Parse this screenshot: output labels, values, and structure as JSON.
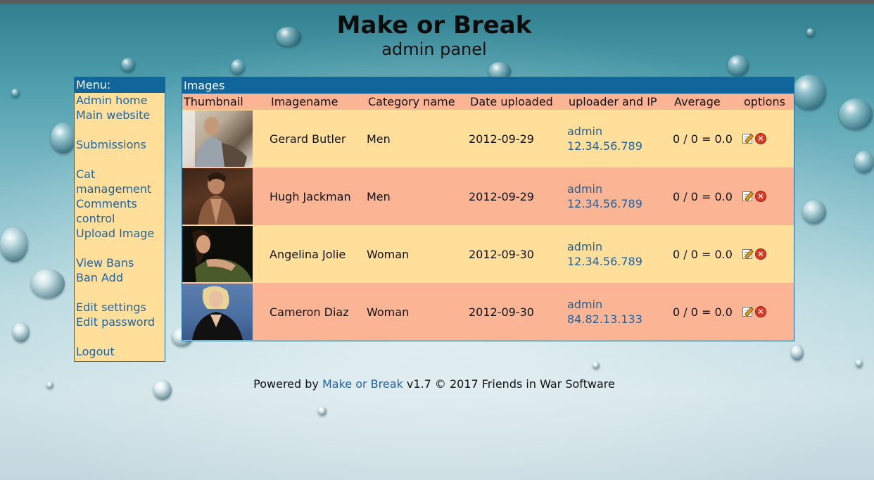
{
  "header": {
    "title": "Make or Break",
    "subtitle": "admin panel"
  },
  "menu": {
    "heading": "Menu:",
    "items": [
      {
        "label": "Admin home"
      },
      {
        "label": "Main website"
      },
      {
        "label": "Submissions"
      },
      {
        "label": "Cat management"
      },
      {
        "label": "Comments control"
      },
      {
        "label": "Upload Image"
      },
      {
        "label": "View Bans"
      },
      {
        "label": "Ban Add"
      },
      {
        "label": "Edit settings"
      },
      {
        "label": "Edit password"
      },
      {
        "label": "Logout"
      }
    ]
  },
  "images": {
    "heading": "Images",
    "columns": [
      "Thumbnail",
      "Imagename",
      "Category name",
      "Date uploaded",
      "uploader and IP",
      "Average",
      "options"
    ],
    "rows": [
      {
        "name": "Gerard Butler",
        "category": "Men",
        "date": "2012-09-29",
        "uploader": "admin",
        "ip": "12.34.56.789",
        "average": "0 / 0 = 0.0"
      },
      {
        "name": "Hugh Jackman",
        "category": "Men",
        "date": "2012-09-29",
        "uploader": "admin",
        "ip": "12.34.56.789",
        "average": "0 / 0 = 0.0"
      },
      {
        "name": "Angelina Jolie",
        "category": "Woman",
        "date": "2012-09-30",
        "uploader": "admin",
        "ip": "12.34.56.789",
        "average": "0 / 0 = 0.0"
      },
      {
        "name": "Cameron Diaz",
        "category": "Woman",
        "date": "2012-09-30",
        "uploader": "admin",
        "ip": "84.82.13.133",
        "average": "0 / 0 = 0.0"
      }
    ]
  },
  "footer": {
    "prefix": "Powered by",
    "link": "Make or Break",
    "suffix": "v1.7 © 2017 Friends in War Software"
  },
  "colors": {
    "accent_blue": "#10659a",
    "link_blue": "#1e63a0",
    "row_light": "#ffdf9a",
    "row_dark": "#fbb595"
  }
}
